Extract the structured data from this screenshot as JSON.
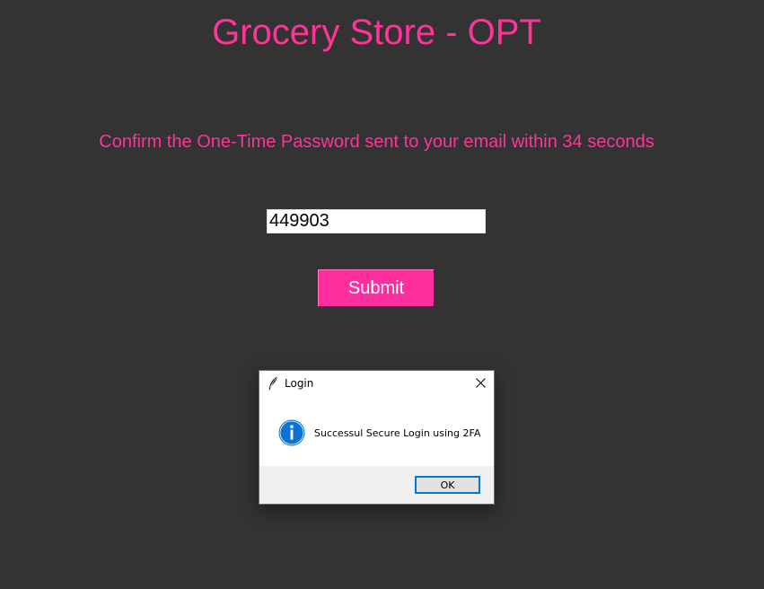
{
  "window": {
    "title": "Grocery Store - OPT",
    "instructions": "Confirm the One-Time Password sent to your email within 34 seconds"
  },
  "form": {
    "otp_value": "449903",
    "submit_label": "Submit"
  },
  "dialog": {
    "title": "Login",
    "message": "Successul Secure Login using 2FA",
    "ok_label": "OK",
    "icons": {
      "titlebar": "feather-icon",
      "message": "info-icon",
      "close": "close-icon"
    }
  },
  "colors": {
    "background": "#333333",
    "accent": "#ff3399",
    "button": "#ff2e9f",
    "info_blue": "#0a74d6"
  }
}
